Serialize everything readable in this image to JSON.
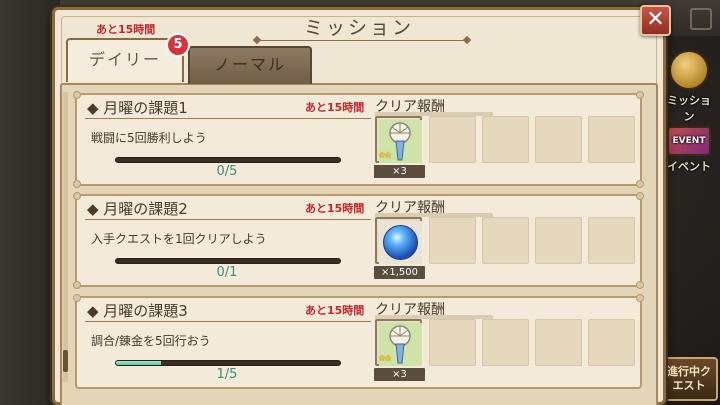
{
  "header": {
    "title": "ミッション",
    "close_icon": "close-icon",
    "tab_remaining": "あと15時間"
  },
  "tabs": [
    {
      "label": "デイリー",
      "active": true,
      "badge": "5"
    },
    {
      "label": "ノーマル",
      "active": false
    }
  ],
  "missions": [
    {
      "name": "◆ 月曜の課題1",
      "time": "あと15時間",
      "description": "戦闘に5回勝利しよう",
      "progress_text": "0/5",
      "progress": 0,
      "reward_header": "クリア報酬",
      "reward_icon": "fan-amulet-icon",
      "reward_qty": "×3"
    },
    {
      "name": "◆ 月曜の課題2",
      "time": "あと15時間",
      "description": "入手クエストを1回クリアしよう",
      "progress_text": "0/1",
      "progress": 0,
      "reward_header": "クリア報酬",
      "reward_icon": "blue-orb-icon",
      "reward_qty": "×1,500"
    },
    {
      "name": "◆ 月曜の課題3",
      "time": "あと15時間",
      "description": "調合/錬金を5回行おう",
      "progress_text": "1/5",
      "progress": 0.2,
      "reward_header": "クリア報酬",
      "reward_icon": "fan-amulet-icon",
      "reward_qty": "×3"
    }
  ],
  "background": {
    "mission_label": "ミッション",
    "event_label": "イベント",
    "event_badge": "EVENT",
    "quest_button": "進行中クエスト"
  },
  "colors": {
    "accent_red": "#c5282a",
    "progress": "#5cbf9a",
    "panel": "#efe6d4"
  }
}
